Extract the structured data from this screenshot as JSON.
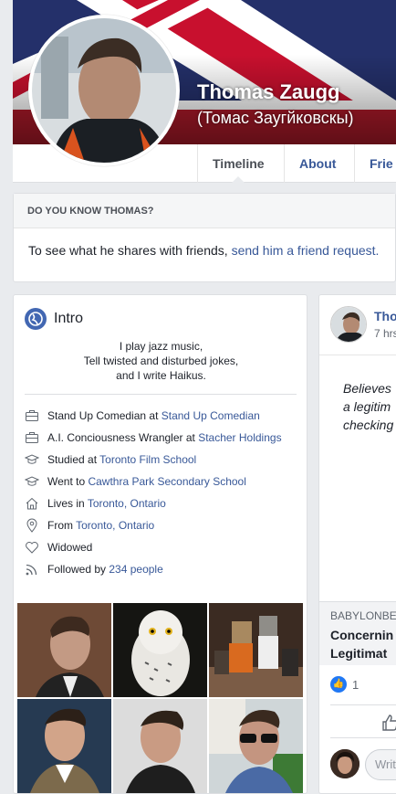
{
  "profile": {
    "name": "Thomas Zaugg",
    "alternate_name": "(Томас Заугйковскы)"
  },
  "tabs": [
    {
      "label": "Timeline",
      "active": true
    },
    {
      "label": "About"
    },
    {
      "label": "Frie"
    }
  ],
  "know": {
    "heading": "DO YOU KNOW THOMAS?",
    "text": "To see what he shares with friends, ",
    "link": "send him a friend request."
  },
  "intro": {
    "title": "Intro",
    "bio": [
      "I play jazz music,",
      "Tell twisted and disturbed jokes,",
      "and I write Haikus."
    ],
    "facts": [
      {
        "icon": "briefcase-icon",
        "text": "Stand Up Comedian at ",
        "link": "Stand Up Comedian"
      },
      {
        "icon": "briefcase-icon",
        "text": "A.I. Conciousness Wrangler at ",
        "link": "Stacher Holdings"
      },
      {
        "icon": "graduation-cap-icon",
        "text": "Studied at ",
        "link": "Toronto Film School"
      },
      {
        "icon": "graduation-cap-icon",
        "text": "Went to ",
        "link": "Cawthra Park Secondary School"
      },
      {
        "icon": "home-icon",
        "text": "Lives in ",
        "link": "Toronto, Ontario"
      },
      {
        "icon": "location-pin-icon",
        "text": "From ",
        "link": "Toronto, Ontario"
      },
      {
        "icon": "heart-icon",
        "text": "Widowed",
        "link": ""
      },
      {
        "icon": "rss-icon",
        "text": "Followed by ",
        "link": "234 people"
      }
    ]
  },
  "post": {
    "author": "Tho",
    "time": "7 hrs",
    "text_lines": [
      "Believes",
      "a legitim",
      "checking"
    ],
    "link_domain": "BABYLONBE",
    "link_title_lines": [
      "Concernin",
      "Legitimat"
    ],
    "like_count": "1",
    "comment_placeholder": "Writ"
  },
  "colors": {
    "link": "#385898",
    "background": "#e9ebee",
    "like_blue": "#2078f4"
  }
}
